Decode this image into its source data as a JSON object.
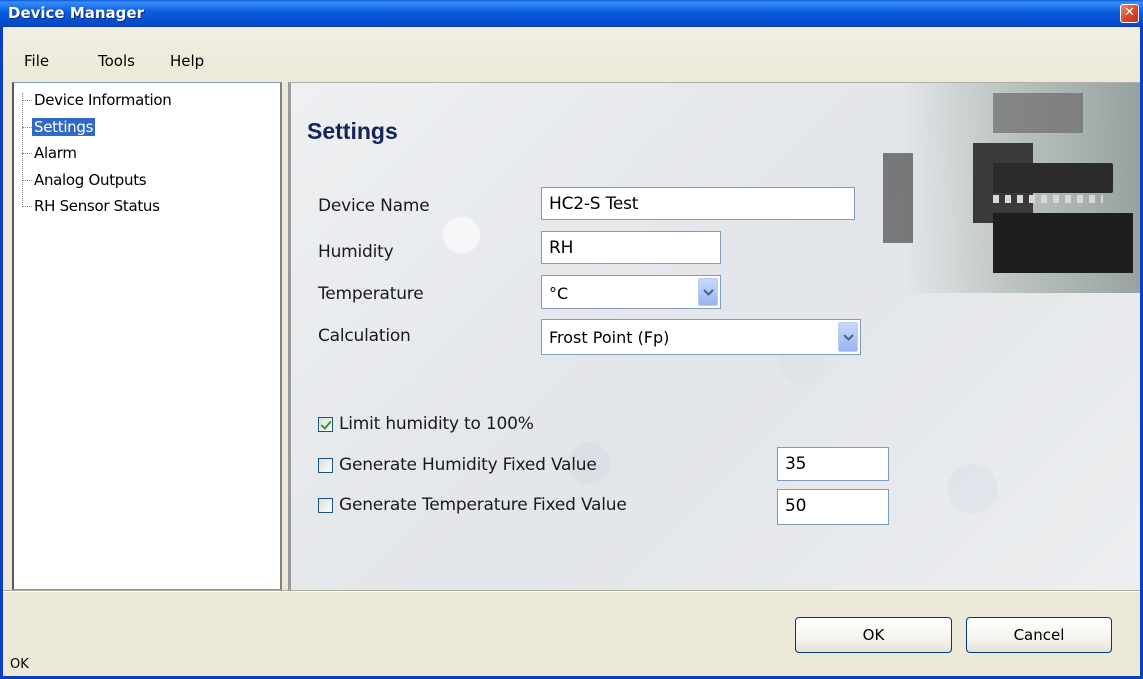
{
  "window": {
    "title": "Device Manager"
  },
  "menu": {
    "items": [
      "File",
      "Tools",
      "Help"
    ]
  },
  "tree": {
    "items": [
      {
        "label": "Device Information",
        "selected": false
      },
      {
        "label": "Settings",
        "selected": true
      },
      {
        "label": "Alarm",
        "selected": false
      },
      {
        "label": "Analog Outputs",
        "selected": false
      },
      {
        "label": "RH Sensor Status",
        "selected": false
      }
    ]
  },
  "settings": {
    "title": "Settings",
    "device_name_label": "Device Name",
    "device_name_value": "HC2-S Test",
    "humidity_label": "Humidity",
    "humidity_value": "RH",
    "temperature_label": "Temperature",
    "temperature_value": "°C",
    "calculation_label": "Calculation",
    "calculation_value": "Frost Point (Fp)",
    "limit_humidity_label": "Limit humidity to 100%",
    "limit_humidity_checked": true,
    "gen_humidity_label": "Generate Humidity Fixed Value",
    "gen_humidity_checked": false,
    "gen_humidity_value": "35",
    "gen_temperature_label": "Generate Temperature Fixed Value",
    "gen_temperature_checked": false,
    "gen_temperature_value": "50"
  },
  "buttons": {
    "ok": "OK",
    "cancel": "Cancel"
  },
  "status": {
    "text": "OK"
  },
  "colors": {
    "title_bar": "#0a5ee0",
    "selection": "#316ac5",
    "heading": "#15245a"
  }
}
